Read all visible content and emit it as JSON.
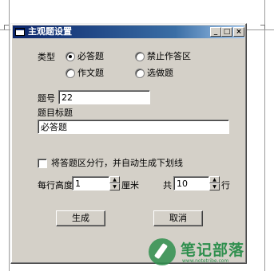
{
  "window": {
    "title": "主观题设置",
    "minimize_glyph": "_",
    "maximize_glyph": "□",
    "close_glyph": "×"
  },
  "type_group": {
    "label": "类型",
    "options": [
      {
        "label": "必答题",
        "checked": true
      },
      {
        "label": "禁止作答区",
        "checked": false
      },
      {
        "label": "作文题",
        "checked": false
      },
      {
        "label": "选做题",
        "checked": false
      }
    ]
  },
  "question_number": {
    "label": "题号",
    "value": "22"
  },
  "question_title": {
    "label": "题目标题",
    "value": "必答题"
  },
  "split_checkbox": {
    "label": "将答题区分行，并自动生成下划线",
    "checked": false
  },
  "row_height": {
    "label": "每行高度",
    "value": "1",
    "unit": "厘米"
  },
  "total_rows": {
    "label": "共",
    "value": "10",
    "unit": "行"
  },
  "buttons": {
    "generate": "生成",
    "cancel": "取消"
  },
  "watermark": {
    "title": "笔记部落",
    "url": "www.notetribe.com",
    "color": "#2f8f4e"
  },
  "colors": {
    "titlebar": "#0a246a",
    "dialog_bg": "#d4d0c8"
  }
}
